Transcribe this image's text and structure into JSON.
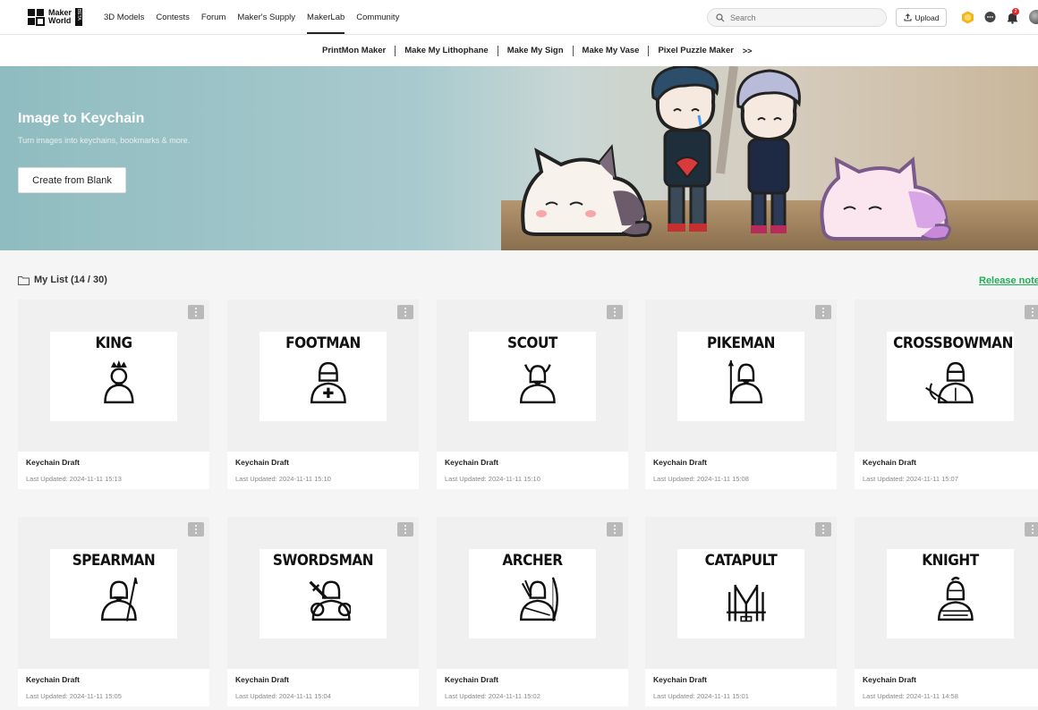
{
  "logo": {
    "line1": "Maker",
    "line2": "World",
    "badge": "BETA"
  },
  "nav": [
    {
      "label": "3D Models"
    },
    {
      "label": "Contests"
    },
    {
      "label": "Forum"
    },
    {
      "label": "Maker's Supply"
    },
    {
      "label": "MakerLab",
      "active": true
    },
    {
      "label": "Community"
    }
  ],
  "search": {
    "placeholder": "Search"
  },
  "upload_label": "Upload",
  "notification_count": "2",
  "subnav": {
    "items": [
      "PrintMon Maker",
      "Make My Lithophane",
      "Make My Sign",
      "Make My Vase",
      "Pixel Puzzle Maker"
    ],
    "more": ">>"
  },
  "hero": {
    "title": "Image to Keychain",
    "subtitle": "Turn images into keychains, bookmarks & more.",
    "button": "Create from Blank"
  },
  "list": {
    "title": "My List (14 / 30)",
    "release_notes": "Release notes"
  },
  "cards": [
    {
      "word": "KING",
      "title": "Keychain Draft",
      "date": "Last Updated: 2024-11-11 15:13"
    },
    {
      "word": "FOOTMAN",
      "title": "Keychain Draft",
      "date": "Last Updated: 2024-11-11 15:10"
    },
    {
      "word": "SCOUT",
      "title": "Keychain Draft",
      "date": "Last Updated: 2024-11-11 15:10"
    },
    {
      "word": "PIKEMAN",
      "title": "Keychain Draft",
      "date": "Last Updated: 2024-11-11 15:08"
    },
    {
      "word": "CROSSBOWMAN",
      "title": "Keychain Draft",
      "date": "Last Updated: 2024-11-11 15:07"
    },
    {
      "word": "SPEARMAN",
      "title": "Keychain Draft",
      "date": "Last Updated: 2024-11-11 15:05"
    },
    {
      "word": "SWORDSMAN",
      "title": "Keychain Draft",
      "date": "Last Updated: 2024-11-11 15:04"
    },
    {
      "word": "ARCHER",
      "title": "Keychain Draft",
      "date": "Last Updated: 2024-11-11 15:02"
    },
    {
      "word": "CATAPULT",
      "title": "Keychain Draft",
      "date": "Last Updated: 2024-11-11 15:01"
    },
    {
      "word": "KNIGHT",
      "title": "Keychain Draft",
      "date": "Last Updated: 2024-11-11 14:58"
    }
  ],
  "colors": {
    "accent": "#1fae55",
    "notification": "#e0262b"
  }
}
